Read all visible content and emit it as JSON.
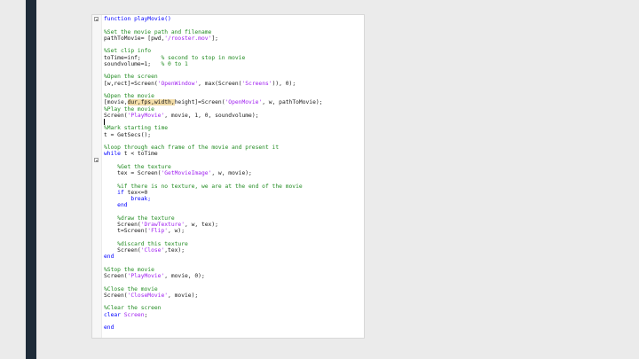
{
  "editor": {
    "lines": [
      {
        "type": "keyword",
        "text": "function playMovie()"
      },
      {
        "type": "blank",
        "text": ""
      },
      {
        "type": "comment",
        "text": "%Set the movie path and filename"
      },
      {
        "type": "code",
        "parts": [
          {
            "t": "pathToMovie= [pwd,"
          },
          {
            "t": "'/rooster.mov'",
            "s": 1
          },
          {
            "t": "];"
          }
        ]
      },
      {
        "type": "blank",
        "text": ""
      },
      {
        "type": "comment",
        "text": "%Set clip info"
      },
      {
        "type": "code",
        "parts": [
          {
            "t": "toTime=inf;      "
          },
          {
            "t": "% second to stop in movie",
            "c": 1
          }
        ]
      },
      {
        "type": "code",
        "parts": [
          {
            "t": "soundvolume=1;   "
          },
          {
            "t": "% 0 to 1",
            "c": 1
          }
        ]
      },
      {
        "type": "blank",
        "text": ""
      },
      {
        "type": "comment",
        "text": "%Open the screen"
      },
      {
        "type": "code",
        "parts": [
          {
            "t": "[w,rect]=Screen("
          },
          {
            "t": "'OpenWindow'",
            "s": 1
          },
          {
            "t": ", max(Screen("
          },
          {
            "t": "'Screens'",
            "s": 1
          },
          {
            "t": ")), 0);"
          }
        ]
      },
      {
        "type": "blank",
        "text": ""
      },
      {
        "type": "comment",
        "text": "%Open the movie"
      },
      {
        "type": "code",
        "parts": [
          {
            "t": "[movie,"
          },
          {
            "t": "dur,fps,width,",
            "h": 1
          },
          {
            "t": "height]=Screen("
          },
          {
            "t": "'OpenMovie'",
            "s": 1
          },
          {
            "t": ", w, pathToMovie);"
          }
        ]
      },
      {
        "type": "comment",
        "text": "%Play the movie"
      },
      {
        "type": "code",
        "parts": [
          {
            "t": "Screen("
          },
          {
            "t": "'PlayMovie'",
            "s": 1
          },
          {
            "t": ", movie, 1, 0, soundvolume);"
          }
        ]
      },
      {
        "type": "cursor",
        "text": ""
      },
      {
        "type": "comment",
        "text": "%Mark starting time"
      },
      {
        "type": "code",
        "parts": [
          {
            "t": "t = GetSecs();"
          }
        ]
      },
      {
        "type": "blank",
        "text": ""
      },
      {
        "type": "comment",
        "text": "%loop through each frame of the movie and present it"
      },
      {
        "type": "code",
        "parts": [
          {
            "t": "while",
            "k": 1
          },
          {
            "t": " t < toTime"
          }
        ]
      },
      {
        "type": "blank",
        "text": ""
      },
      {
        "type": "comment",
        "text": "    %Get the texture"
      },
      {
        "type": "code",
        "parts": [
          {
            "t": "    tex = Screen("
          },
          {
            "t": "'GetMovieImage'",
            "s": 1
          },
          {
            "t": ", w, movie);"
          }
        ]
      },
      {
        "type": "blank",
        "text": ""
      },
      {
        "type": "comment",
        "text": "    %if there is no texture, we are at the end of the movie"
      },
      {
        "type": "code",
        "parts": [
          {
            "t": "    if",
            "k": 1
          },
          {
            "t": " tex<=0"
          }
        ]
      },
      {
        "type": "keyword",
        "text": "        break;"
      },
      {
        "type": "keyword",
        "text": "    end"
      },
      {
        "type": "blank",
        "text": ""
      },
      {
        "type": "comment",
        "text": "    %draw the texture"
      },
      {
        "type": "code",
        "parts": [
          {
            "t": "    Screen("
          },
          {
            "t": "'DrawTexture'",
            "s": 1
          },
          {
            "t": ", w, tex);"
          }
        ]
      },
      {
        "type": "code",
        "parts": [
          {
            "t": "    t=Screen("
          },
          {
            "t": "'Flip'",
            "s": 1
          },
          {
            "t": ", w);"
          }
        ]
      },
      {
        "type": "blank",
        "text": ""
      },
      {
        "type": "comment",
        "text": "    %discard this texture"
      },
      {
        "type": "code",
        "parts": [
          {
            "t": "    Screen("
          },
          {
            "t": "'Close'",
            "s": 1
          },
          {
            "t": ",tex);"
          }
        ]
      },
      {
        "type": "keyword",
        "text": "end"
      },
      {
        "type": "blank",
        "text": ""
      },
      {
        "type": "comment",
        "text": "%Stop the movie"
      },
      {
        "type": "code",
        "parts": [
          {
            "t": "Screen("
          },
          {
            "t": "'PlayMovie'",
            "s": 1
          },
          {
            "t": ", movie, 0);"
          }
        ]
      },
      {
        "type": "blank",
        "text": ""
      },
      {
        "type": "comment",
        "text": "%Close the movie"
      },
      {
        "type": "code",
        "parts": [
          {
            "t": "Screen("
          },
          {
            "t": "'CloseMovie'",
            "s": 1
          },
          {
            "t": ", movie);"
          }
        ]
      },
      {
        "type": "blank",
        "text": ""
      },
      {
        "type": "comment",
        "text": "%Clear the screen"
      },
      {
        "type": "code",
        "parts": [
          {
            "t": "clear",
            "k": 1
          },
          {
            "t": " "
          },
          {
            "t": "Screen",
            "s": 1
          },
          {
            "t": ";"
          }
        ]
      },
      {
        "type": "blank",
        "text": ""
      },
      {
        "type": "keyword",
        "text": "end"
      }
    ]
  }
}
